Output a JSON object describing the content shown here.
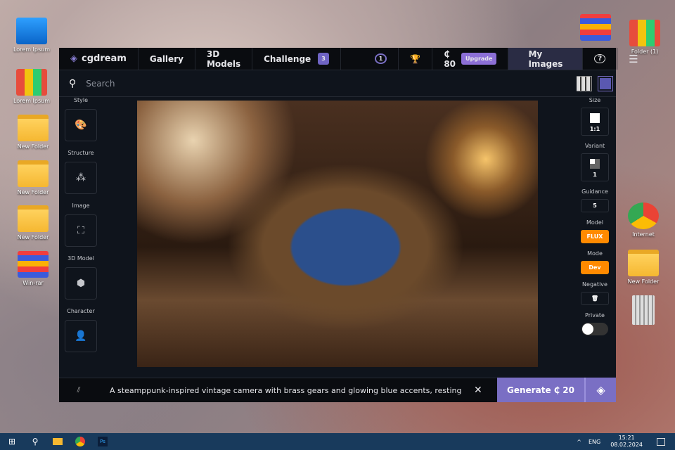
{
  "desktop": {
    "left_icons": [
      "Lorem Ipsum",
      "Lorem Ipsum",
      "New Folder",
      "New Folder",
      "New Folder",
      "Win-rar"
    ],
    "right_icons": [
      "Folder (1)",
      "Internet",
      "New Folder"
    ]
  },
  "app": {
    "brand": "cgdream",
    "nav": [
      "Gallery",
      "3D Models",
      "Challenge"
    ],
    "challenge_count": "3",
    "level": "1",
    "credits": "₵ 80",
    "upgrade": "Upgrade",
    "my_images": "My Images",
    "help": "?",
    "menu": "☰"
  },
  "search": {
    "placeholder": "Search"
  },
  "left_panel": [
    {
      "label": "Style",
      "icon": "🎨"
    },
    {
      "label": "Structure",
      "icon": "⁂"
    },
    {
      "label": "Image",
      "icon": "⛶"
    },
    {
      "label": "3D Model",
      "icon": "⬢"
    },
    {
      "label": "Character",
      "icon": "👤"
    }
  ],
  "right_panel": {
    "size_label": "Size",
    "size": "1:1",
    "variant_label": "Variant",
    "variant": "1",
    "guidance_label": "Guidance",
    "guidance": "5",
    "model_label": "Model",
    "model": "FLUX",
    "mode_label": "Mode",
    "mode": "Dev",
    "negative_label": "Negative",
    "private_label": "Private",
    "private_on": false
  },
  "prompt": {
    "text": "A steamppunk-inspired vintage camera with brass gears and glowing blue accents, resting on a wooden…",
    "generate": "Generate ₵ 20"
  },
  "taskbar": {
    "lang": "ENG",
    "time": "15:21",
    "date": "08.02.2024"
  }
}
